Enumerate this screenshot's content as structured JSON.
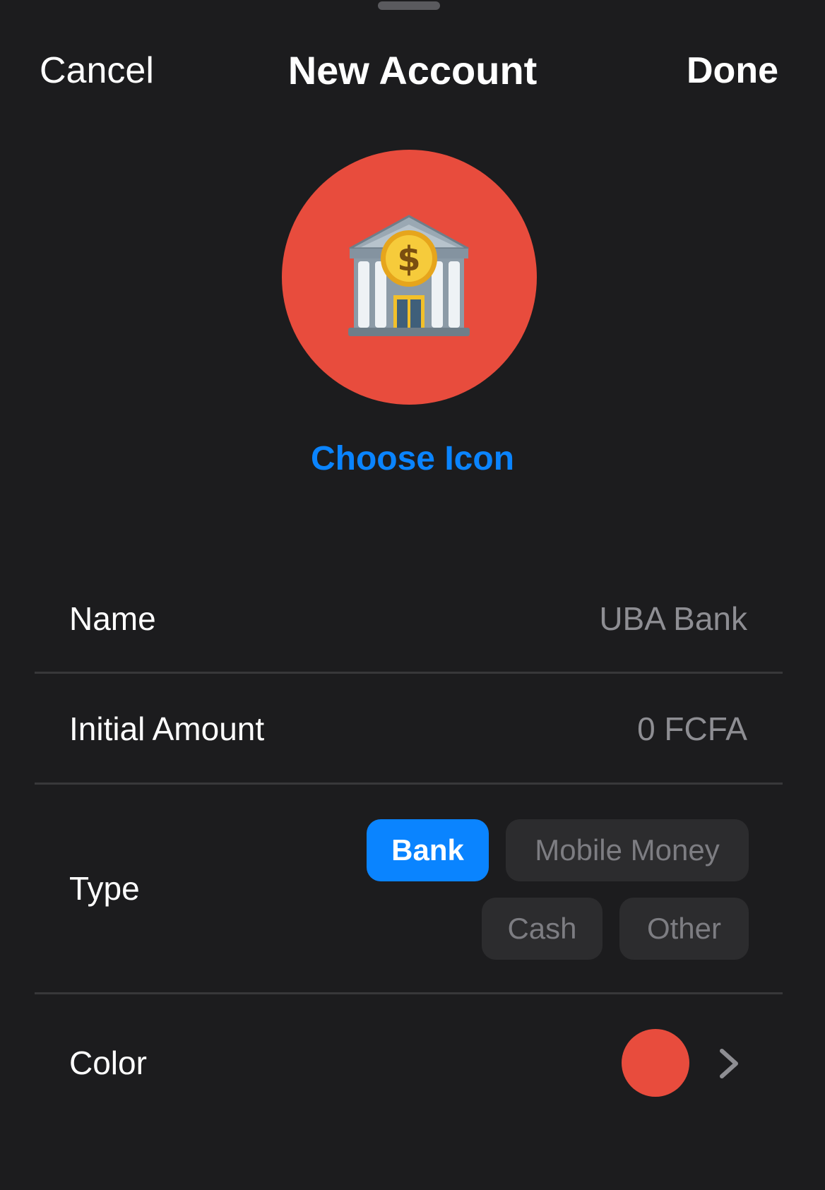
{
  "header": {
    "cancel_label": "Cancel",
    "title": "New Account",
    "done_label": "Done"
  },
  "icon_picker": {
    "icon": "bank-icon",
    "circle_color": "#e84c3d",
    "choose_label": "Choose Icon"
  },
  "form": {
    "name": {
      "label": "Name",
      "placeholder": "UBA Bank"
    },
    "initial_amount": {
      "label": "Initial Amount",
      "placeholder": "0 FCFA"
    },
    "type": {
      "label": "Type",
      "options": [
        "Bank",
        "Mobile Money",
        "Cash",
        "Other"
      ],
      "selected": "Bank"
    },
    "color": {
      "label": "Color",
      "value": "#e84c3d",
      "chevron_icon": "chevron-right-icon"
    }
  },
  "colors": {
    "background": "#1c1c1e",
    "accent": "#0a84ff",
    "chip_background": "#2c2c2e",
    "secondary_text": "#8e8e93",
    "divider": "#38383a"
  }
}
